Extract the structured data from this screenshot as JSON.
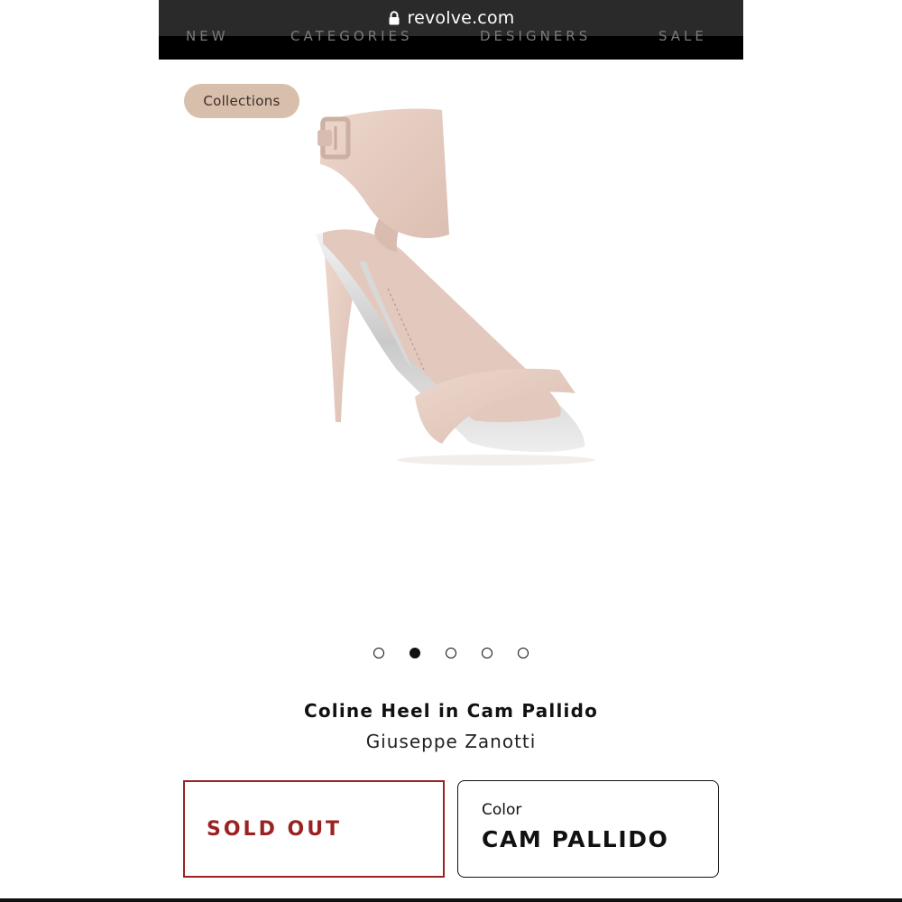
{
  "browser": {
    "url": "revolve.com",
    "nav_items": [
      "NEW",
      "CATEGORIES",
      "DESIGNERS",
      "SALE"
    ]
  },
  "badge": {
    "label": "Collections"
  },
  "product": {
    "title": "Coline Heel in Cam Pallido",
    "brand": "Giuseppe Zanotti",
    "image_icon": "sandal-image",
    "status": "SOLD OUT",
    "color_label": "Color",
    "color_value": "CAM PALLIDO"
  },
  "carousel": {
    "count": 5,
    "active_index": 1
  },
  "colors": {
    "pill": "#d8bfab",
    "sold_out": "#9b2222",
    "suede": "#e7cfc4"
  }
}
